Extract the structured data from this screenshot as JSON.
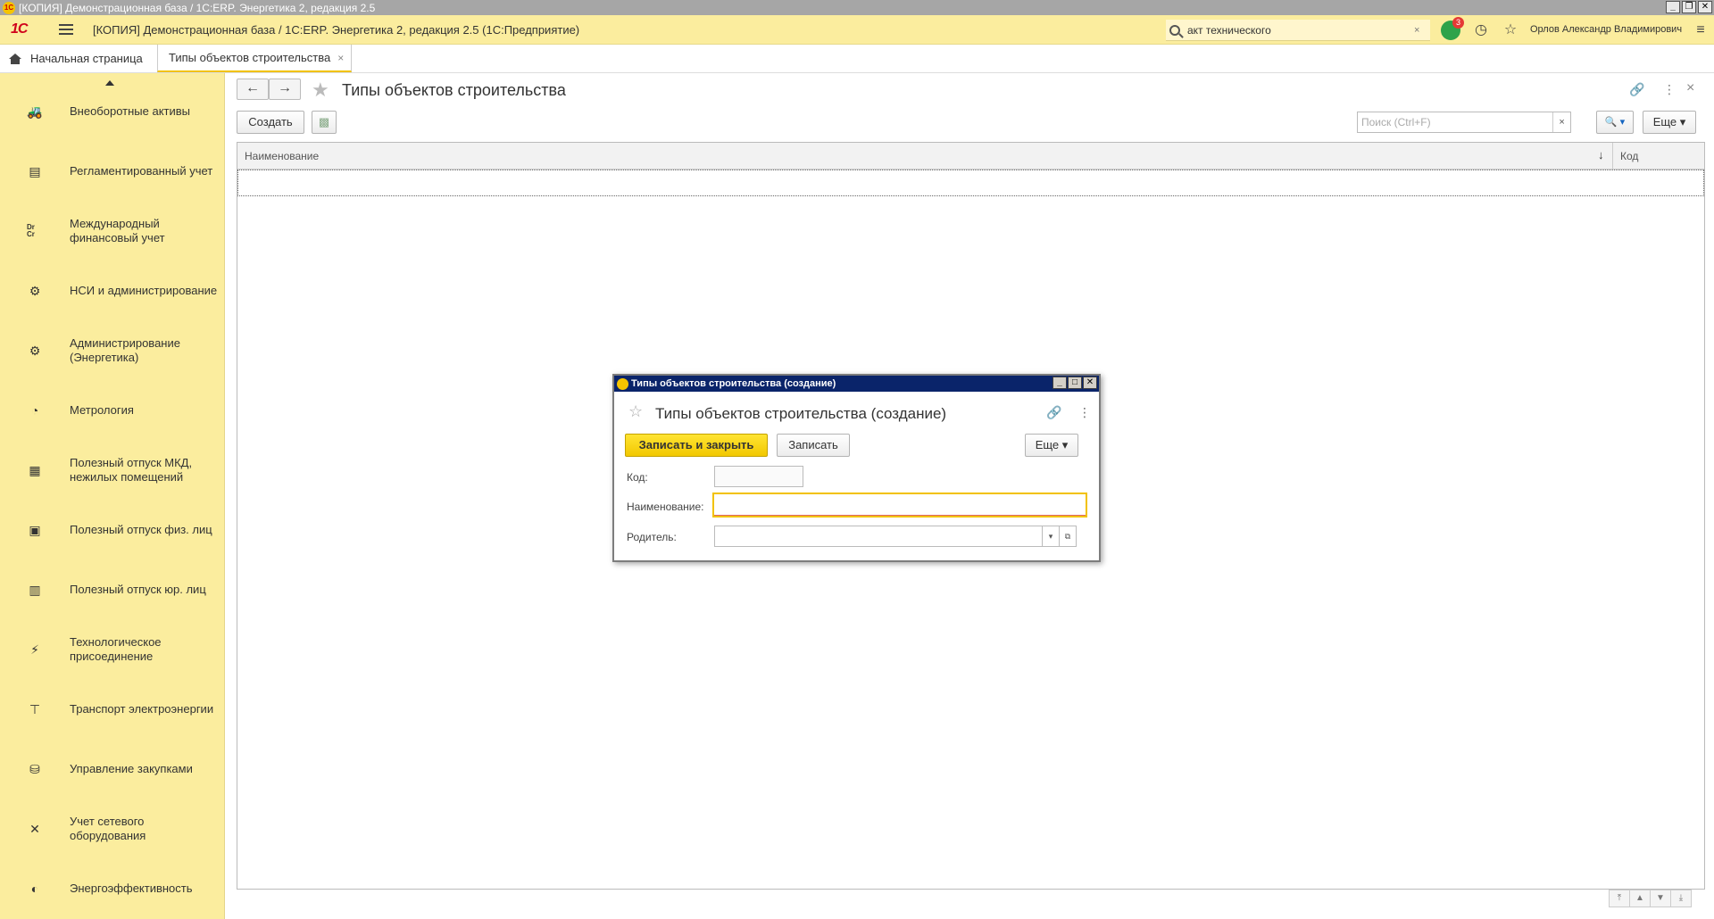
{
  "os_window": {
    "title": "[КОПИЯ] Демонстрационная база / 1С:ERP. Энергетика 2, редакция 2.5",
    "logo": "1С",
    "minimize": "_",
    "maximize": "❐",
    "close": "✕"
  },
  "header": {
    "logo": "1С",
    "title": "[КОПИЯ] Демонстрационная база / 1С:ERP. Энергетика 2, редакция 2.5  (1С:Предприятие)",
    "search_value": "акт технического",
    "search_clear": "×",
    "notifications_count": "3",
    "history_icon": "◷",
    "favorites_icon": "☆",
    "user": "Орлов Александр Владимирович",
    "settings_icon": "≡"
  },
  "tabs": {
    "home": "Начальная страница",
    "active": "Типы объектов строительства",
    "close": "×"
  },
  "sidebar": {
    "items": [
      {
        "label": "Внеоборотные активы",
        "icon": "🚜"
      },
      {
        "label": "Регламентированный учет",
        "icon": "▤"
      },
      {
        "label": "Международный финансовый учет",
        "icon": "Dr Cr"
      },
      {
        "label": "НСИ и администрирование",
        "icon": "⚙"
      },
      {
        "label": "Администрирование (Энергетика)",
        "icon": "⚙"
      },
      {
        "label": "Метрология",
        "icon": "◔"
      },
      {
        "label": "Полезный отпуск МКД, нежилых помещений",
        "icon": "▦"
      },
      {
        "label": "Полезный отпуск физ. лиц",
        "icon": "▣"
      },
      {
        "label": "Полезный отпуск юр. лиц",
        "icon": "▥"
      },
      {
        "label": "Технологическое присоединение",
        "icon": "⚡"
      },
      {
        "label": "Транспорт электроэнергии",
        "icon": "⊤"
      },
      {
        "label": "Управление закупками",
        "icon": "⛁"
      },
      {
        "label": "Учет сетевого оборудования",
        "icon": "✕"
      },
      {
        "label": "Энергоэффективность",
        "icon": "◐"
      }
    ]
  },
  "main": {
    "back": "←",
    "forward": "→",
    "star": "★",
    "title": "Типы объектов строительства",
    "link_icon": "🔗",
    "more_icon": "⋮",
    "close_icon": "×",
    "create_label": "Создать",
    "copy_icon": "▩",
    "search_placeholder": "Поиск (Ctrl+F)",
    "search_clear": "×",
    "search_btn": "🔍 ▾",
    "more_label": "Еще ▾",
    "columns": {
      "name": "Наименование",
      "sort": "↓",
      "code": "Код"
    },
    "scroll": [
      "⤒",
      "▲",
      "▼",
      "⤓"
    ]
  },
  "dialog": {
    "titlebar": "Типы объектов строительства (создание)",
    "title": "Типы объектов строительства (создание)",
    "star": "☆",
    "link_icon": "🔗",
    "more_icon": "⋮",
    "save_close": "Записать и закрыть",
    "save": "Записать",
    "more": "Еще ▾",
    "fields": {
      "code_label": "Код:",
      "code_value": "",
      "name_label": "Наименование:",
      "name_value": "",
      "parent_label": "Родитель:",
      "parent_value": "",
      "parent_dropdown": "▾",
      "parent_open": "⧉"
    },
    "btn_min": "_",
    "btn_max": "□",
    "btn_close": "✕"
  },
  "colors": {
    "accent_yellow": "#fbed9e",
    "button_yellow": "#f2c800",
    "dialog_title": "#0a246a"
  }
}
